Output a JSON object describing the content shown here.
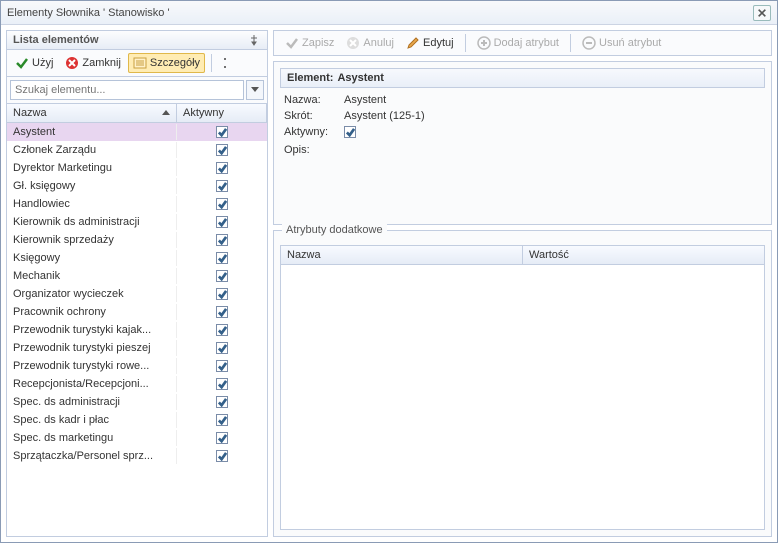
{
  "window": {
    "title": "Elementy Słownika  ' Stanowisko '"
  },
  "leftPanel": {
    "header": "Lista elementów",
    "toolbar": {
      "use": "Użyj",
      "close": "Zamknij",
      "details": "Szczegóły"
    },
    "search": {
      "placeholder": "Szukaj elementu..."
    },
    "columns": {
      "name": "Nazwa",
      "active": "Aktywny"
    },
    "rows": [
      {
        "name": "Asystent",
        "active": true,
        "selected": true
      },
      {
        "name": "Członek Zarządu",
        "active": true
      },
      {
        "name": "Dyrektor Marketingu",
        "active": true
      },
      {
        "name": "Gł. księgowy",
        "active": true
      },
      {
        "name": "Handlowiec",
        "active": true
      },
      {
        "name": "Kierownik ds administracji",
        "active": true
      },
      {
        "name": "Kierownik sprzedaży",
        "active": true
      },
      {
        "name": "Księgowy",
        "active": true
      },
      {
        "name": "Mechanik",
        "active": true
      },
      {
        "name": "Organizator wycieczek",
        "active": true
      },
      {
        "name": "Pracownik ochrony",
        "active": true
      },
      {
        "name": "Przewodnik turystyki kajak...",
        "active": true
      },
      {
        "name": "Przewodnik turystyki pieszej",
        "active": true
      },
      {
        "name": "Przewodnik turystyki rowe...",
        "active": true
      },
      {
        "name": "Recepcjonista/Recepcjoni...",
        "active": true
      },
      {
        "name": "Spec. ds administracji",
        "active": true
      },
      {
        "name": "Spec. ds kadr i płac",
        "active": true
      },
      {
        "name": "Spec. ds marketingu",
        "active": true
      },
      {
        "name": "Sprzątaczka/Personel sprz...",
        "active": true
      }
    ]
  },
  "rightToolbar": {
    "save": "Zapisz",
    "cancel": "Anuluj",
    "edit": "Edytuj",
    "addAttr": "Dodaj atrybut",
    "delAttr": "Usuń atrybut"
  },
  "form": {
    "titlePrefix": "Element:",
    "titleValue": "Asystent",
    "labels": {
      "name": "Nazwa:",
      "short": "Skrót:",
      "active": "Aktywny:",
      "desc": "Opis:"
    },
    "values": {
      "name": "Asystent",
      "short": "Asystent (125-1)",
      "active": true,
      "desc": ""
    }
  },
  "attr": {
    "group": "Atrybuty dodatkowe",
    "cols": {
      "name": "Nazwa",
      "value": "Wartość"
    }
  }
}
